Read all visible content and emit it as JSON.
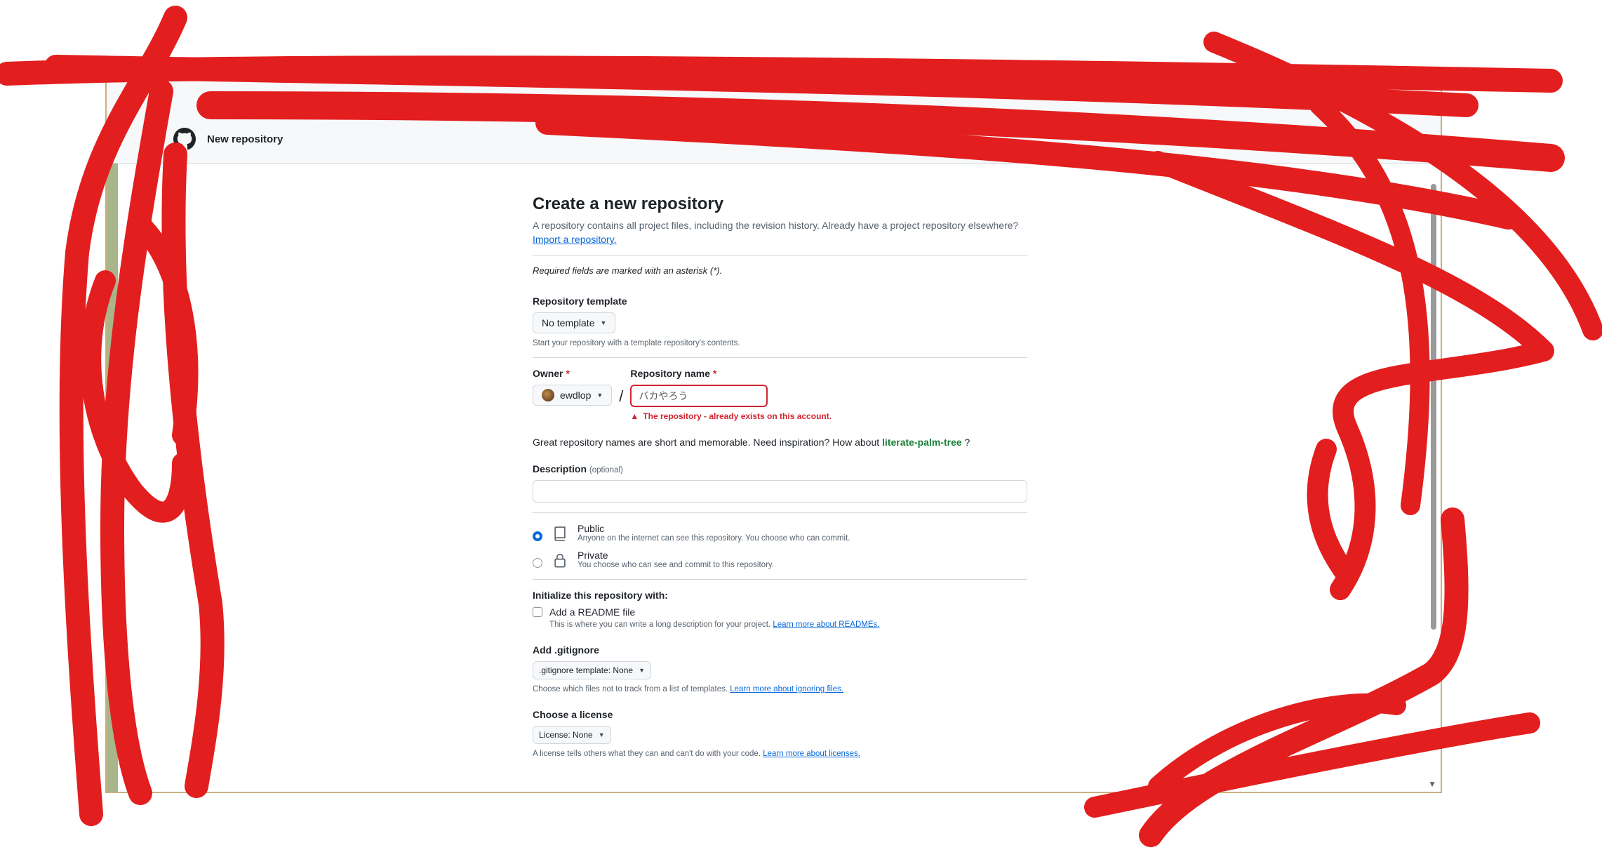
{
  "header": {
    "title": "New repository"
  },
  "page": {
    "title": "Create a new repository",
    "subtitle": "A repository contains all project files, including the revision history. Already have a project repository elsewhere?",
    "import_link": "Import a repository.",
    "required_note": "Required fields are marked with an asterisk (*)."
  },
  "template": {
    "label": "Repository template",
    "value": "No template",
    "help": "Start your repository with a template repository's contents."
  },
  "owner": {
    "label": "Owner",
    "asterisk": "*",
    "value": "ewdlop"
  },
  "repo_name": {
    "label": "Repository name",
    "asterisk": "*",
    "separator": "/",
    "value": "バカやろう",
    "error": "The repository - already exists on this account."
  },
  "inspiration": {
    "text": "Great repository names are short and memorable. Need inspiration? How about",
    "suggestion": "literate-palm-tree",
    "tail": "?"
  },
  "description": {
    "label": "Description",
    "optional": "(optional)"
  },
  "visibility": {
    "public": {
      "title": "Public",
      "desc": "Anyone on the internet can see this repository. You choose who can commit."
    },
    "private": {
      "title": "Private",
      "desc": "You choose who can see and commit to this repository."
    }
  },
  "init": {
    "label": "Initialize this repository with:",
    "readme_label": "Add a README file",
    "readme_help": "This is where you can write a long description for your project.",
    "readme_link": "Learn more about READMEs."
  },
  "gitignore": {
    "label": "Add .gitignore",
    "button": ".gitignore template: None",
    "help": "Choose which files not to track from a list of templates.",
    "link": "Learn more about ignoring files."
  },
  "license": {
    "label": "Choose a license",
    "button": "License: None",
    "help": "A license tells others what they can and can't do with your code.",
    "link": "Learn more about licenses."
  },
  "colors": {
    "scribble": "#e31e1e",
    "accent": "#0969da",
    "error": "#d1242f",
    "success": "#1a7f37"
  }
}
